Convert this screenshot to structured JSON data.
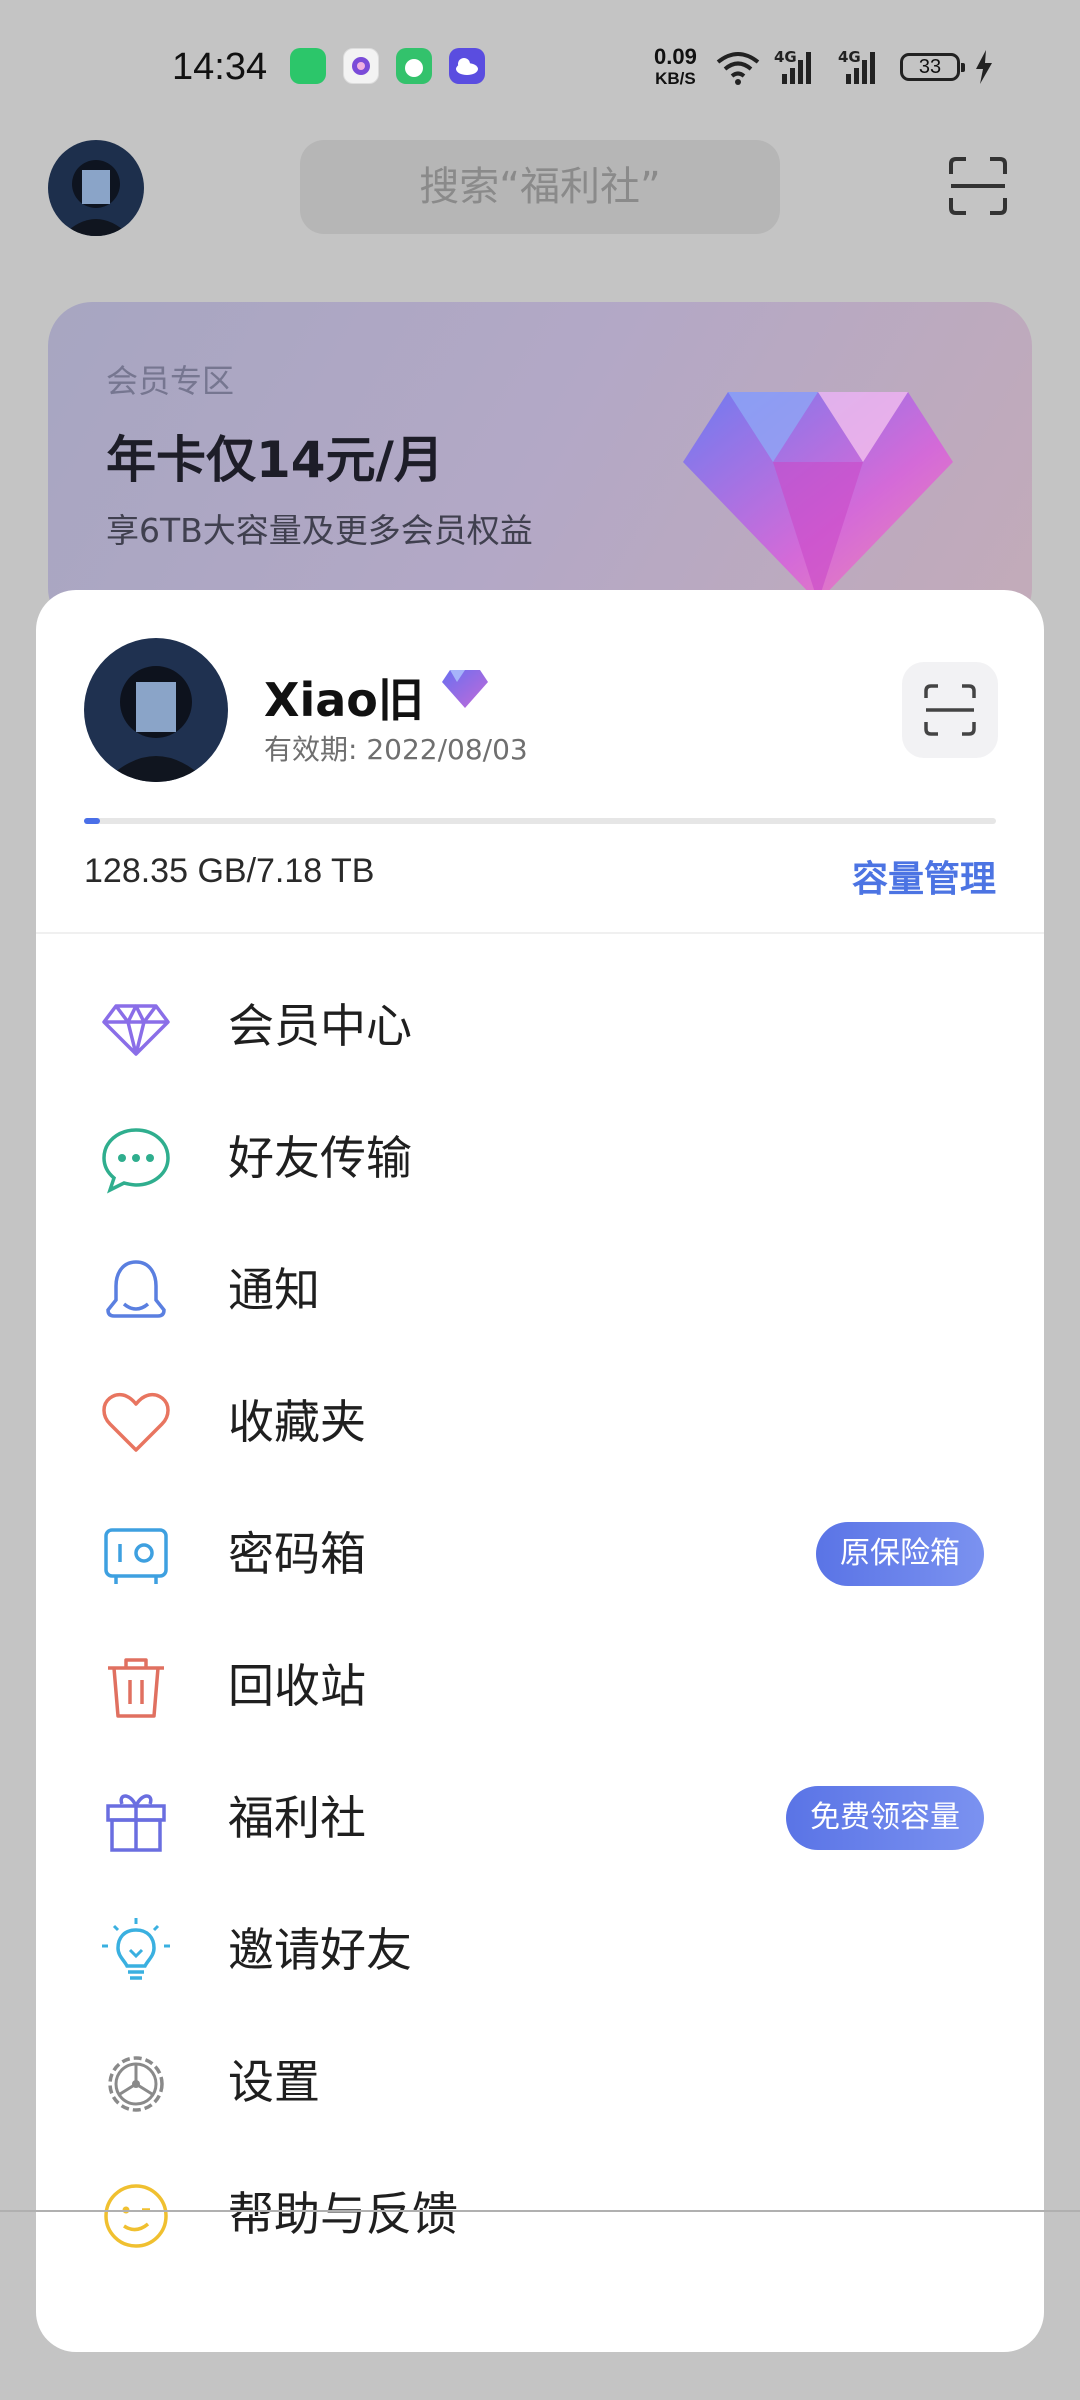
{
  "status_bar": {
    "time": "14:34",
    "net_speed_value": "0.09",
    "net_speed_unit": "KB/S",
    "signal_1": "4G",
    "signal_2": "4G",
    "battery": "33",
    "icons": [
      "wechat-icon",
      "camera-app-icon",
      "game-app-icon",
      "cloud-app-icon",
      "wifi-icon",
      "signal-icon",
      "signal-icon",
      "battery-icon",
      "charging-icon"
    ]
  },
  "header": {
    "search_placeholder": "搜索“福利社”"
  },
  "promo": {
    "tag": "会员专区",
    "title": "年卡仅14元/月",
    "subtitle": "享6TB大容量及更多会员权益"
  },
  "profile": {
    "username": "Xiao旧",
    "validity": "有效期: 2022/08/03",
    "storage_text": "128.35 GB/7.18 TB",
    "storage_used_fraction": 0.017,
    "capacity_link": "容量管理"
  },
  "menu": [
    {
      "label": "会员中心",
      "icon": "diamond-icon",
      "color": "#8a6ee8"
    },
    {
      "label": "好友传输",
      "icon": "chat-icon",
      "color": "#2fae8e"
    },
    {
      "label": "通知",
      "icon": "bell-icon",
      "color": "#5a7fe0"
    },
    {
      "label": "收藏夹",
      "icon": "heart-icon",
      "color": "#e87560"
    },
    {
      "label": "密码箱",
      "icon": "safe-icon",
      "color": "#3ea0e0",
      "badge": "原保险箱"
    },
    {
      "label": "回收站",
      "icon": "trash-icon",
      "color": "#e07060"
    },
    {
      "label": "福利社",
      "icon": "gift-icon",
      "color": "#6a6ee0",
      "badge": "免费领容量"
    },
    {
      "label": "邀请好友",
      "icon": "lightbulb-icon",
      "color": "#3ab0e0"
    },
    {
      "label": "设置",
      "icon": "gear-icon",
      "color": "#8a8a8a"
    },
    {
      "label": "帮助与反馈",
      "icon": "smile-icon",
      "color": "#f0c030"
    }
  ],
  "colors": {
    "accent": "#4c74e3",
    "badge": "#5a74e6",
    "overlay": "#c4c4c4"
  }
}
